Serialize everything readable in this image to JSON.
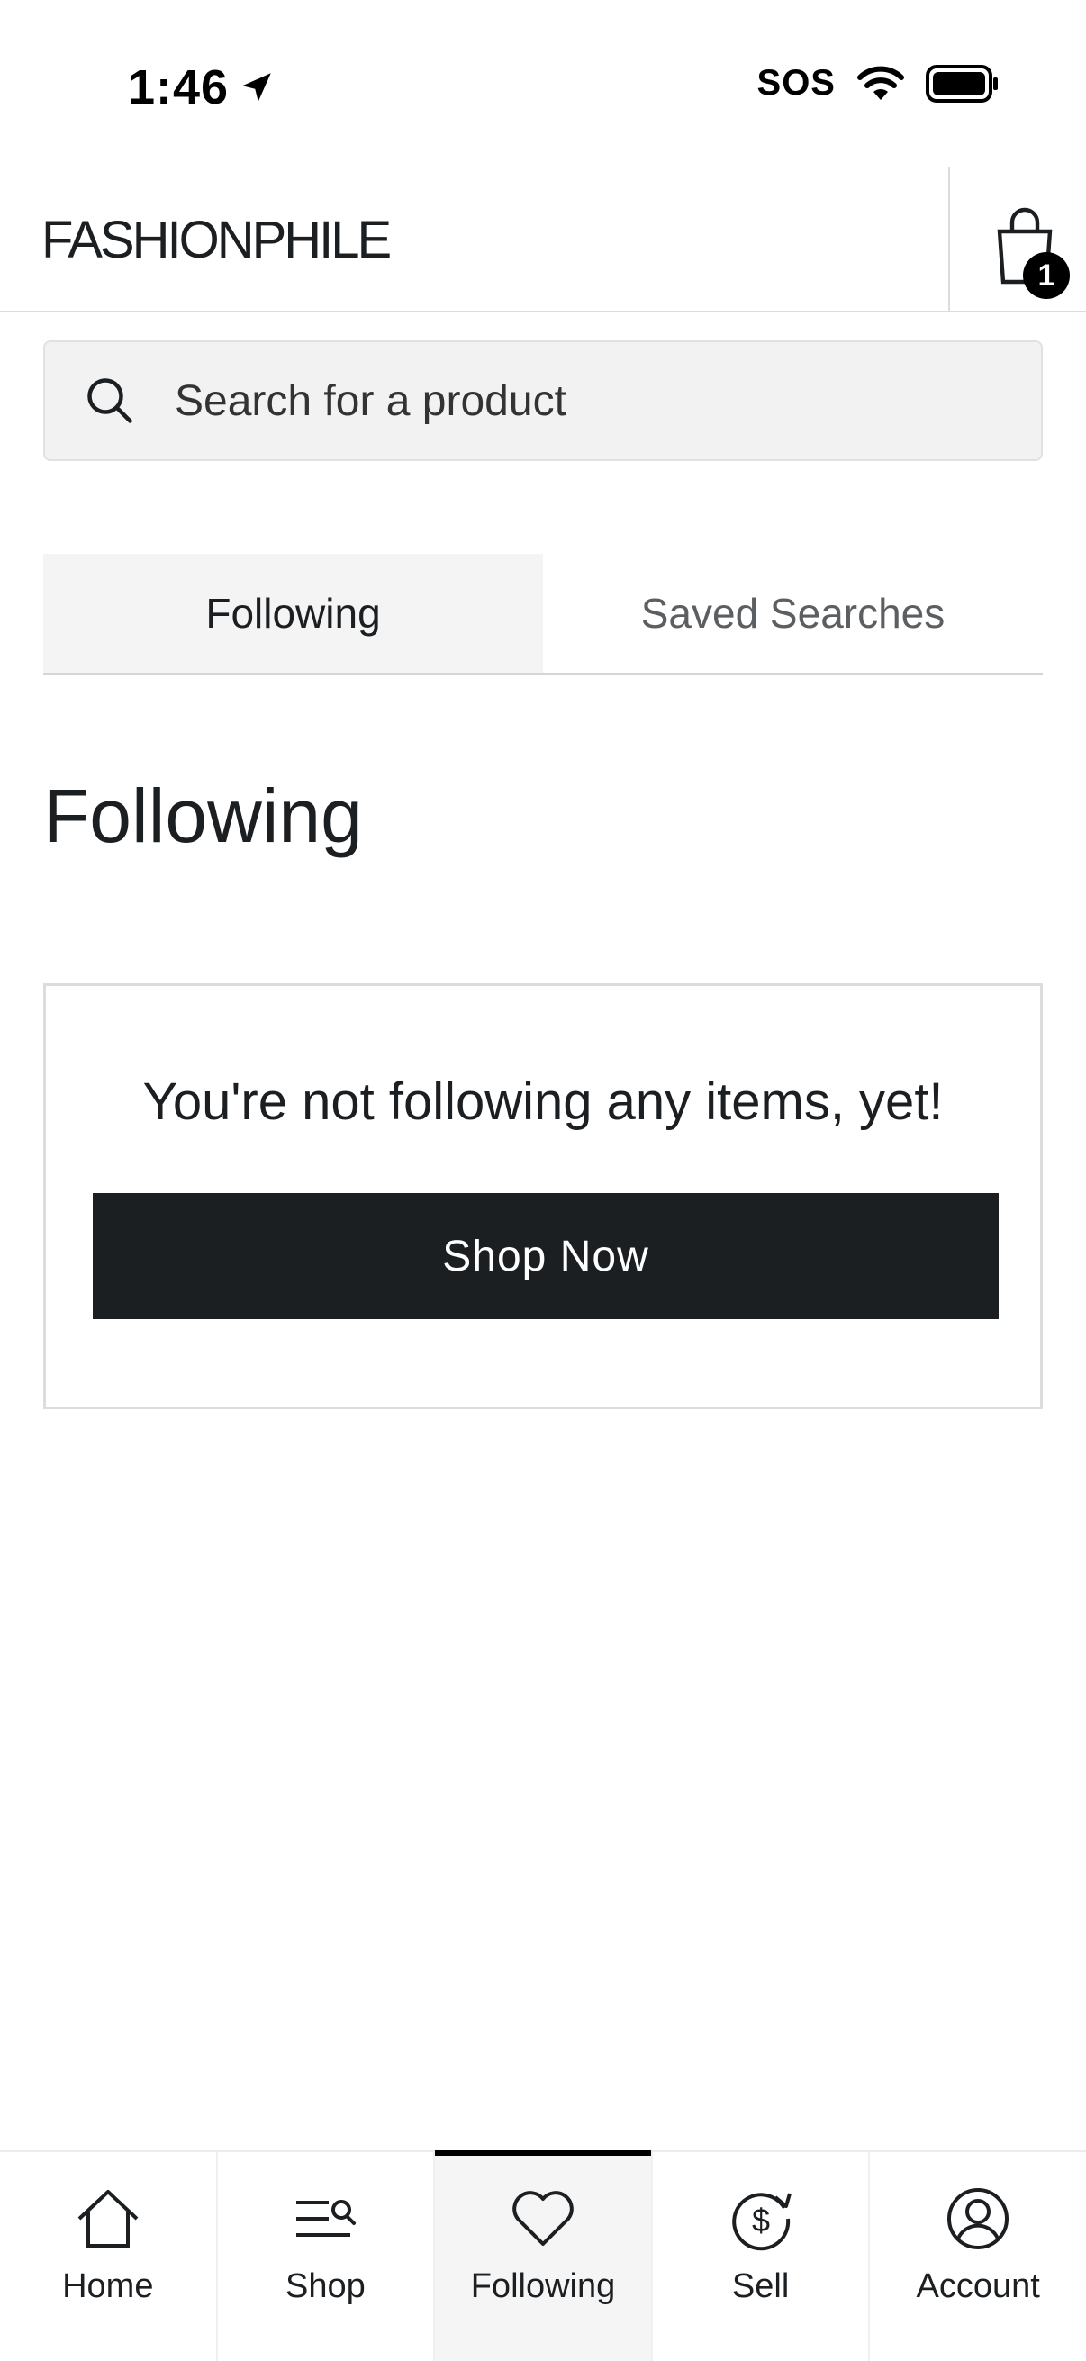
{
  "status_bar": {
    "time": "1:46",
    "sos": "SOS"
  },
  "header": {
    "logo": "FASHIONPHILE",
    "cart_count": "1"
  },
  "search": {
    "placeholder": "Search for a product"
  },
  "tabs": [
    {
      "label": "Following",
      "active": true
    },
    {
      "label": "Saved Searches",
      "active": false
    }
  ],
  "main": {
    "title": "Following",
    "empty_message": "You're not following any items, yet!",
    "shop_now_label": "Shop Now"
  },
  "bottom_nav": [
    {
      "label": "Home",
      "icon": "home-icon"
    },
    {
      "label": "Shop",
      "icon": "shop-search-icon"
    },
    {
      "label": "Following",
      "icon": "heart-icon",
      "active": true
    },
    {
      "label": "Sell",
      "icon": "dollar-cycle-icon"
    },
    {
      "label": "Account",
      "icon": "account-icon"
    }
  ]
}
